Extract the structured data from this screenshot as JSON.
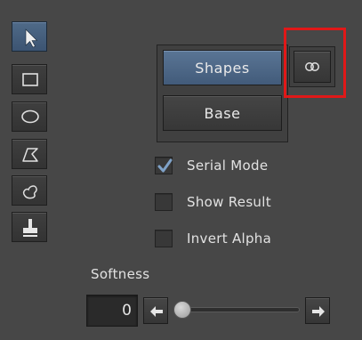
{
  "tools": [
    {
      "name": "select-arrow-icon",
      "active": true
    },
    {
      "name": "rectangle-icon",
      "active": false
    },
    {
      "name": "ellipse-icon",
      "active": false
    },
    {
      "name": "polygon-icon",
      "active": false
    },
    {
      "name": "freehand-icon",
      "active": false
    },
    {
      "name": "stamp-icon",
      "active": false
    }
  ],
  "buttons": {
    "shapes_label": "Shapes",
    "base_label": "Base",
    "link_icon": "link-icon"
  },
  "options": [
    {
      "label": "Serial Mode",
      "checked": true
    },
    {
      "label": "Show Result",
      "checked": false
    },
    {
      "label": "Invert Alpha",
      "checked": false
    }
  ],
  "softness": {
    "label": "Softness",
    "value": "0",
    "slider_level": 0
  },
  "colors": {
    "accent": "#4f6a88",
    "highlight": "#e01818"
  }
}
